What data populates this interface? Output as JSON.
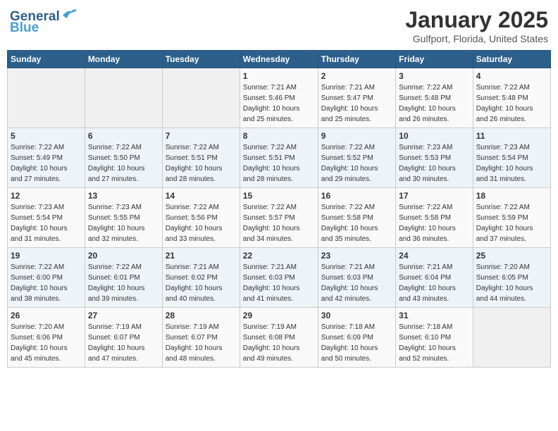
{
  "header": {
    "logo_line1": "General",
    "logo_line2": "Blue",
    "month": "January 2025",
    "location": "Gulfport, Florida, United States"
  },
  "weekdays": [
    "Sunday",
    "Monday",
    "Tuesday",
    "Wednesday",
    "Thursday",
    "Friday",
    "Saturday"
  ],
  "weeks": [
    [
      {
        "day": "",
        "info": ""
      },
      {
        "day": "",
        "info": ""
      },
      {
        "day": "",
        "info": ""
      },
      {
        "day": "1",
        "info": "Sunrise: 7:21 AM\nSunset: 5:46 PM\nDaylight: 10 hours\nand 25 minutes."
      },
      {
        "day": "2",
        "info": "Sunrise: 7:21 AM\nSunset: 5:47 PM\nDaylight: 10 hours\nand 25 minutes."
      },
      {
        "day": "3",
        "info": "Sunrise: 7:22 AM\nSunset: 5:48 PM\nDaylight: 10 hours\nand 26 minutes."
      },
      {
        "day": "4",
        "info": "Sunrise: 7:22 AM\nSunset: 5:48 PM\nDaylight: 10 hours\nand 26 minutes."
      }
    ],
    [
      {
        "day": "5",
        "info": "Sunrise: 7:22 AM\nSunset: 5:49 PM\nDaylight: 10 hours\nand 27 minutes."
      },
      {
        "day": "6",
        "info": "Sunrise: 7:22 AM\nSunset: 5:50 PM\nDaylight: 10 hours\nand 27 minutes."
      },
      {
        "day": "7",
        "info": "Sunrise: 7:22 AM\nSunset: 5:51 PM\nDaylight: 10 hours\nand 28 minutes."
      },
      {
        "day": "8",
        "info": "Sunrise: 7:22 AM\nSunset: 5:51 PM\nDaylight: 10 hours\nand 28 minutes."
      },
      {
        "day": "9",
        "info": "Sunrise: 7:22 AM\nSunset: 5:52 PM\nDaylight: 10 hours\nand 29 minutes."
      },
      {
        "day": "10",
        "info": "Sunrise: 7:23 AM\nSunset: 5:53 PM\nDaylight: 10 hours\nand 30 minutes."
      },
      {
        "day": "11",
        "info": "Sunrise: 7:23 AM\nSunset: 5:54 PM\nDaylight: 10 hours\nand 31 minutes."
      }
    ],
    [
      {
        "day": "12",
        "info": "Sunrise: 7:23 AM\nSunset: 5:54 PM\nDaylight: 10 hours\nand 31 minutes."
      },
      {
        "day": "13",
        "info": "Sunrise: 7:23 AM\nSunset: 5:55 PM\nDaylight: 10 hours\nand 32 minutes."
      },
      {
        "day": "14",
        "info": "Sunrise: 7:22 AM\nSunset: 5:56 PM\nDaylight: 10 hours\nand 33 minutes."
      },
      {
        "day": "15",
        "info": "Sunrise: 7:22 AM\nSunset: 5:57 PM\nDaylight: 10 hours\nand 34 minutes."
      },
      {
        "day": "16",
        "info": "Sunrise: 7:22 AM\nSunset: 5:58 PM\nDaylight: 10 hours\nand 35 minutes."
      },
      {
        "day": "17",
        "info": "Sunrise: 7:22 AM\nSunset: 5:58 PM\nDaylight: 10 hours\nand 36 minutes."
      },
      {
        "day": "18",
        "info": "Sunrise: 7:22 AM\nSunset: 5:59 PM\nDaylight: 10 hours\nand 37 minutes."
      }
    ],
    [
      {
        "day": "19",
        "info": "Sunrise: 7:22 AM\nSunset: 6:00 PM\nDaylight: 10 hours\nand 38 minutes."
      },
      {
        "day": "20",
        "info": "Sunrise: 7:22 AM\nSunset: 6:01 PM\nDaylight: 10 hours\nand 39 minutes."
      },
      {
        "day": "21",
        "info": "Sunrise: 7:21 AM\nSunset: 6:02 PM\nDaylight: 10 hours\nand 40 minutes."
      },
      {
        "day": "22",
        "info": "Sunrise: 7:21 AM\nSunset: 6:03 PM\nDaylight: 10 hours\nand 41 minutes."
      },
      {
        "day": "23",
        "info": "Sunrise: 7:21 AM\nSunset: 6:03 PM\nDaylight: 10 hours\nand 42 minutes."
      },
      {
        "day": "24",
        "info": "Sunrise: 7:21 AM\nSunset: 6:04 PM\nDaylight: 10 hours\nand 43 minutes."
      },
      {
        "day": "25",
        "info": "Sunrise: 7:20 AM\nSunset: 6:05 PM\nDaylight: 10 hours\nand 44 minutes."
      }
    ],
    [
      {
        "day": "26",
        "info": "Sunrise: 7:20 AM\nSunset: 6:06 PM\nDaylight: 10 hours\nand 45 minutes."
      },
      {
        "day": "27",
        "info": "Sunrise: 7:19 AM\nSunset: 6:07 PM\nDaylight: 10 hours\nand 47 minutes."
      },
      {
        "day": "28",
        "info": "Sunrise: 7:19 AM\nSunset: 6:07 PM\nDaylight: 10 hours\nand 48 minutes."
      },
      {
        "day": "29",
        "info": "Sunrise: 7:19 AM\nSunset: 6:08 PM\nDaylight: 10 hours\nand 49 minutes."
      },
      {
        "day": "30",
        "info": "Sunrise: 7:18 AM\nSunset: 6:09 PM\nDaylight: 10 hours\nand 50 minutes."
      },
      {
        "day": "31",
        "info": "Sunrise: 7:18 AM\nSunset: 6:10 PM\nDaylight: 10 hours\nand 52 minutes."
      },
      {
        "day": "",
        "info": ""
      }
    ]
  ]
}
